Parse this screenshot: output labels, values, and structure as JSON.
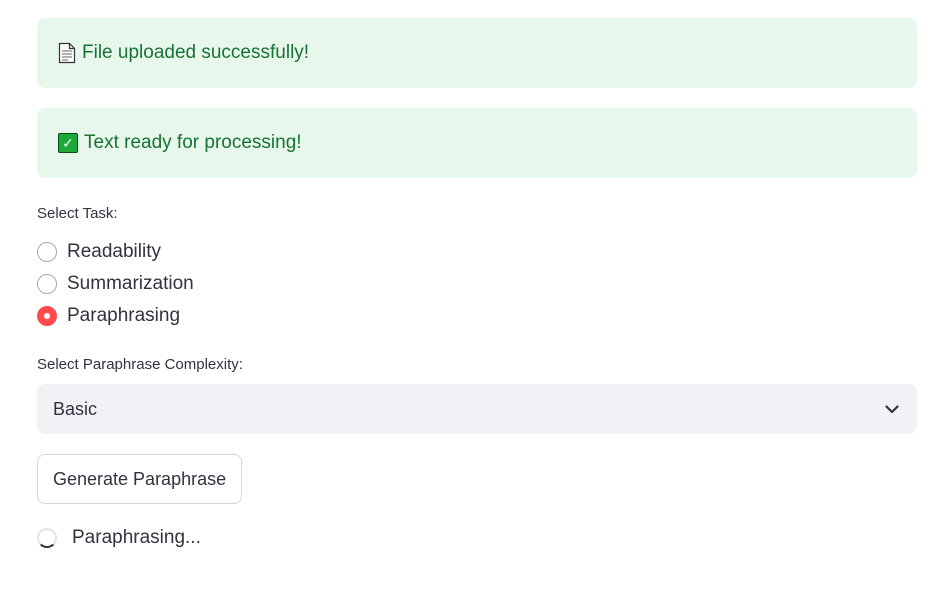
{
  "alerts": [
    {
      "icon": "document-icon",
      "text": "File uploaded successfully!"
    },
    {
      "icon": "check-mark-icon",
      "text": "Text ready for processing!"
    }
  ],
  "task": {
    "label": "Select Task:",
    "options": [
      {
        "label": "Readability",
        "selected": false
      },
      {
        "label": "Summarization",
        "selected": false
      },
      {
        "label": "Paraphrasing",
        "selected": true
      }
    ]
  },
  "complexity": {
    "label": "Select Paraphrase Complexity:",
    "value": "Basic"
  },
  "generate_button": {
    "label": "Generate Paraphrase"
  },
  "status": {
    "text": "Paraphrasing..."
  },
  "colors": {
    "success_bg": "#e8f7ec",
    "success_text": "#177233",
    "accent": "#ff4b4b",
    "select_bg": "#f0f2f6"
  }
}
